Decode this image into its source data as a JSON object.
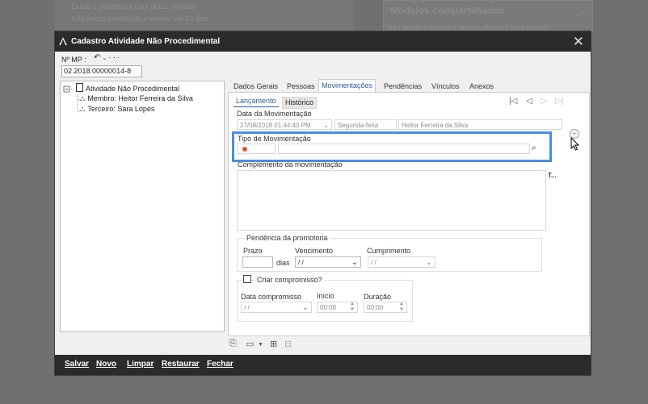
{
  "background": {
    "pending_line1": "Existe 1 pendência com prazo vencido",
    "pending_line2": "Não existe pendência a vencer até 10 dias",
    "shared_models_title": "Modelos compartilhados",
    "shared_models_text": "Não existem modelos compartilhados pelo usuário"
  },
  "dialog": {
    "title": "Cadastro Atividade Não Procedimental",
    "mp_label": "Nº MP :",
    "mp_value": "02.2018.00000014-8"
  },
  "tree": {
    "root": "Atividade Não Procedimental",
    "children": [
      "Membro: Heitor Ferreira da Silva",
      "Terceiro: Sara Lopes"
    ]
  },
  "tabs": [
    "Dados Gerais",
    "Pessoas",
    "Movimentações",
    "Pendências",
    "Vínculos",
    "Anexos"
  ],
  "active_tab": "Movimentações",
  "subtabs": [
    "Lançamento",
    "Histórico"
  ],
  "movimentacao": {
    "data_label": "Data da Movimentação",
    "data_value": "27/08/2018 01:44:40 PM",
    "weekday": "Segunda-feira",
    "member": "Heitor Ferreira da Silva",
    "tipo_label": "Tipo de Movimentação",
    "complemento_label": "Complemento da movimentação",
    "text_tool": "T..."
  },
  "pendencia": {
    "group_label": "Pendência da promotoria",
    "prazo_label": "Prazo",
    "dias_label": "dias",
    "vencimento_label": "Vencimento",
    "vencimento_value": "/ /",
    "cumprimento_label": "Cumprimento",
    "cumprimento_value": "/ /"
  },
  "compromisso": {
    "checkbox_label": "Criar compromisso?",
    "data_label": "Data compromisso",
    "data_value": "/ /",
    "inicio_label": "Início",
    "inicio_value": "00:00",
    "duracao_label": "Duração",
    "duracao_value": "00:00"
  },
  "bottom_buttons": [
    "Salvar",
    "Novo",
    "Limpar",
    "Restaurar",
    "Fechar"
  ],
  "colors": {
    "highlight": "#4a8ee0",
    "required_dot": "#e0533a",
    "titlebar": "#2b2b2b"
  }
}
